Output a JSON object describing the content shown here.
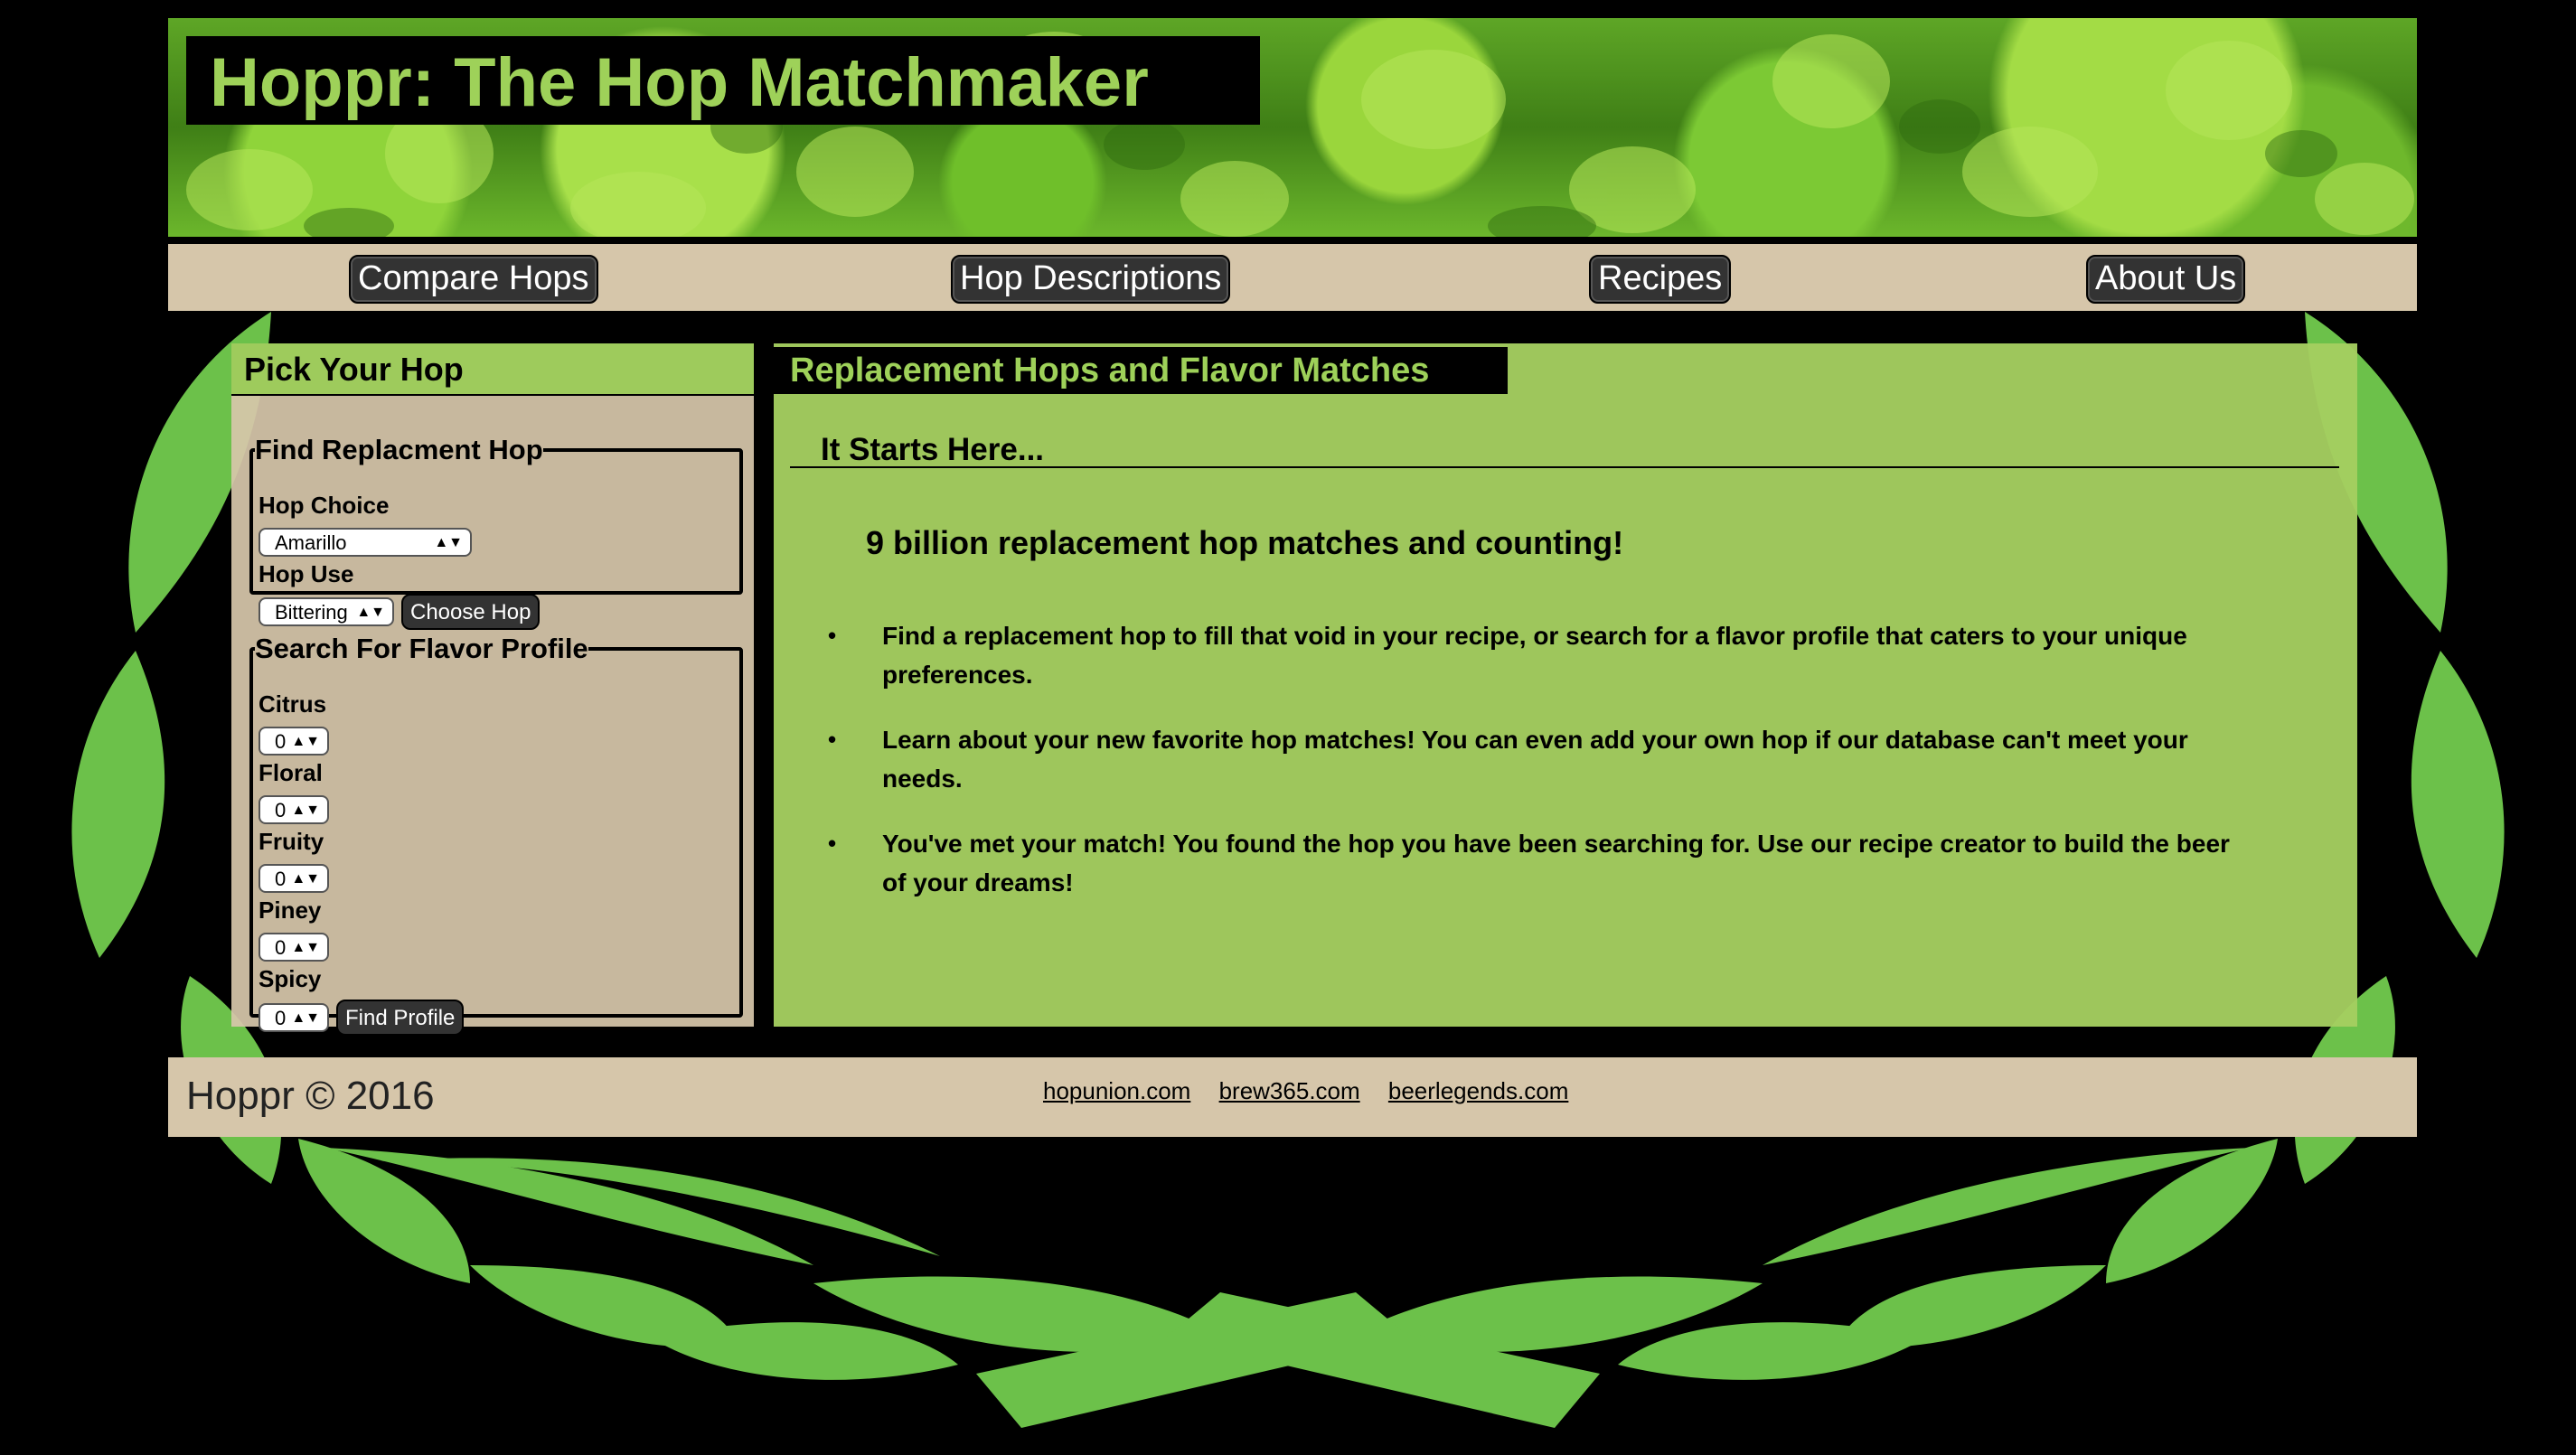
{
  "header": {
    "title": "Hoppr: The Hop Matchmaker"
  },
  "nav": {
    "items": [
      {
        "label": "Compare Hops"
      },
      {
        "label": "Hop Descriptions"
      },
      {
        "label": "Recipes"
      },
      {
        "label": "About Us"
      }
    ]
  },
  "sidebar": {
    "title": "Pick Your Hop",
    "replacement": {
      "legend": "Find Replacment Hop",
      "hop_choice_label": "Hop Choice",
      "hop_choice_value": "Amarillo",
      "hop_use_label": "Hop Use",
      "hop_use_value": "Bittering",
      "choose_button": "Choose Hop"
    },
    "flavor": {
      "legend": "Search For Flavor Profile",
      "fields": [
        {
          "label": "Citrus",
          "value": "0"
        },
        {
          "label": "Floral",
          "value": "0"
        },
        {
          "label": "Fruity",
          "value": "0"
        },
        {
          "label": "Piney",
          "value": "0"
        },
        {
          "label": "Spicy",
          "value": "0"
        }
      ],
      "find_button": "Find Profile"
    }
  },
  "main": {
    "title": "Replacement Hops and Flavor Matches",
    "subtitle": "It Starts Here...",
    "tagline": "9 billion replacement hop matches and counting!",
    "bullets": [
      "Find a replacement hop to fill that void in your recipe, or search for a flavor profile that caters to your unique preferences.",
      "Learn about your new favorite hop matches! You can even add your own hop if our database can't meet your needs.",
      "You've met your match! You found the hop you have been searching for. Use our recipe creator to build the beer of your dreams!"
    ]
  },
  "footer": {
    "copyright": "Hoppr © 2016",
    "links": [
      "hopunion.com",
      "brew365.com",
      "beerlegends.com"
    ]
  },
  "colors": {
    "accent_green": "#9ed159",
    "panel_green": "#a4ce60",
    "tan": "#d6c6aa",
    "wreath_green": "#6cc14a"
  }
}
